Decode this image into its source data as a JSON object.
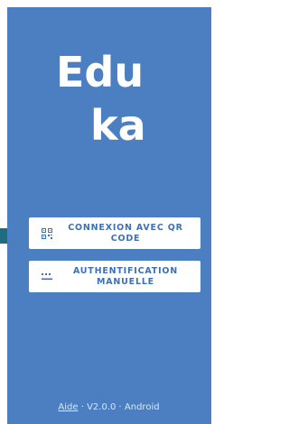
{
  "logo": {
    "line1": "Edu",
    "line2": "ka"
  },
  "buttons": {
    "qr": {
      "label": "CONNEXION AVEC QR\nCODE",
      "icon": "qr-code-icon"
    },
    "manual": {
      "label": "AUTHENTIFICATION\nMANUELLE",
      "icon": "keyboard-icon"
    }
  },
  "footer": {
    "help": "Aide",
    "version": " · V2.0.0 · Android"
  },
  "colors": {
    "background": "#4b7fc2",
    "button_text": "#3d70b5",
    "side_marker": "#1f6b80"
  }
}
